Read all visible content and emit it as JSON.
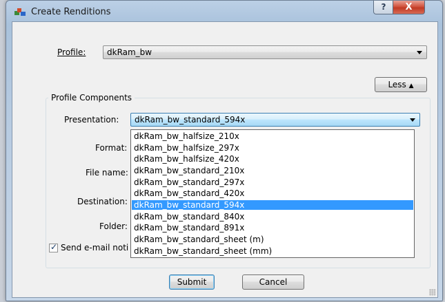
{
  "window": {
    "title": "Create Renditions",
    "icon": "renditions-app-icon",
    "help_label": "?",
    "close_label": "X"
  },
  "profile": {
    "label": "Profile:",
    "value": "dkRam_bw"
  },
  "less_button": {
    "label": "Less",
    "icon": "arrow-up-icon"
  },
  "components": {
    "group_title": "Profile Components",
    "presentation_label": "Presentation:",
    "presentation_value": "dkRam_bw_standard_594x",
    "format_label": "Format:",
    "file_name_label": "File name:",
    "destination_label": "Destination:",
    "folder_label": "Folder:",
    "send_email_label": "Send e-mail noti",
    "send_email_checked": true
  },
  "dropdown": {
    "selected_index": 6,
    "options": [
      "dkRam_bw_halfsize_210x",
      "dkRam_bw_halfsize_297x",
      "dkRam_bw_halfsize_420x",
      "dkRam_bw_standard_210x",
      "dkRam_bw_standard_297x",
      "dkRam_bw_standard_420x",
      "dkRam_bw_standard_594x",
      "dkRam_bw_standard_840x",
      "dkRam_bw_standard_891x",
      "dkRam_bw_standard_sheet (m)",
      "dkRam_bw_standard_sheet (mm)"
    ]
  },
  "buttons": {
    "submit": "Submit",
    "cancel": "Cancel"
  },
  "colors": {
    "selection": "#3399ff",
    "window_frame": "#a9c2dc",
    "close_button": "#c13a24"
  }
}
